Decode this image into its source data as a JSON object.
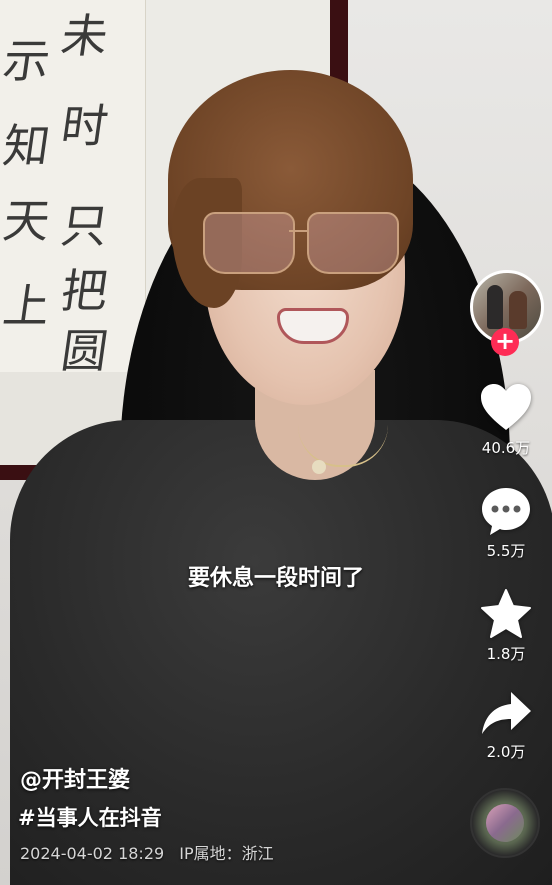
{
  "video": {
    "subtitle": "要休息一段时间了",
    "calligraphy_left": [
      "未",
      "示",
      "知",
      "天",
      "上"
    ],
    "calligraphy_right": [
      "时",
      "只",
      "把",
      "圆"
    ]
  },
  "rail": {
    "follow_symbol": "+",
    "likes": "40.6万",
    "comments": "5.5万",
    "favorites": "1.8万",
    "shares": "2.0万",
    "icons": [
      "heart-icon",
      "comment-icon",
      "star-icon",
      "share-icon"
    ]
  },
  "info": {
    "author": "@开封王婆",
    "hashtag": "#当事人在抖音",
    "datetime": "2024-04-02 18:29",
    "ip_location": "IP属地：浙江"
  },
  "colors": {
    "follow_accent": "#fe2c55",
    "text": "#ffffff"
  }
}
